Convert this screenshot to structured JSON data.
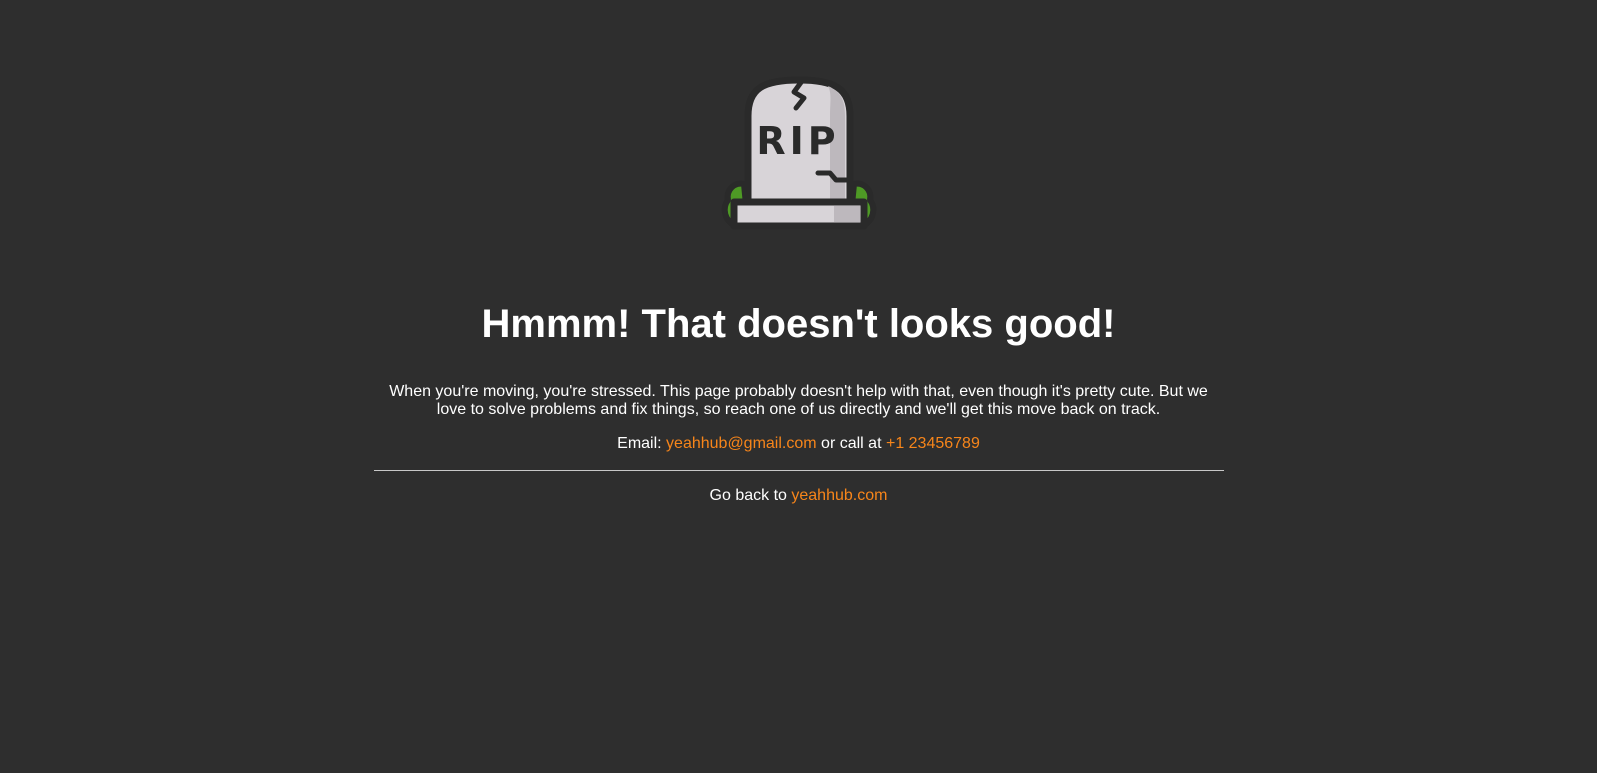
{
  "illustration": {
    "icon": "rip-tombstone-icon",
    "label": "RIP"
  },
  "heading": "Hmmm! That doesn't looks good!",
  "message": "When you're moving, you're stressed. This page probably doesn't help with that, even though it's pretty cute. But we love to solve problems and fix things, so reach one of us directly and we'll get this move back on track.",
  "contact": {
    "email_prefix": "Email:",
    "email": "yeahhub@gmail.com",
    "call_prefix": "or call at",
    "phone": "+1 23456789"
  },
  "goback": {
    "prefix": "Go back to",
    "link": "yeahhub.com"
  },
  "colors": {
    "background": "#2e2e2e",
    "text": "#ffffff",
    "link": "#f7851a",
    "grass": "#4e9a25",
    "stone": "#d8d4d8",
    "stone_shade": "#bdb8bd",
    "outline": "#2a2a2a"
  }
}
